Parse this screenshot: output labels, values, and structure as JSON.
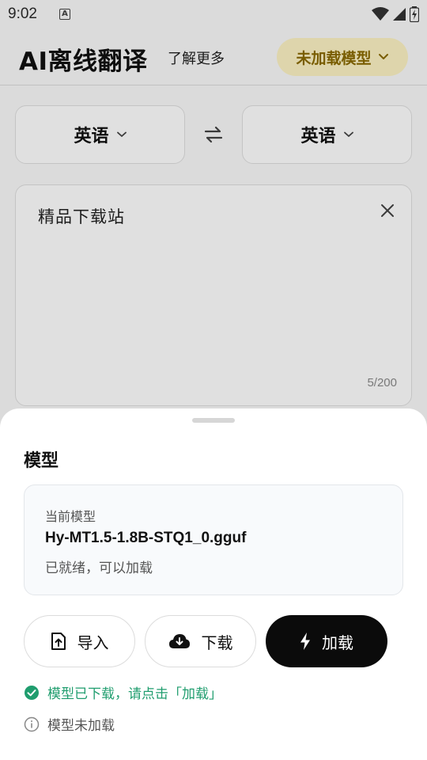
{
  "status_bar": {
    "time": "9:02",
    "notification_glyph": "A",
    "icons": [
      "wifi-icon",
      "signal-icon",
      "battery-icon"
    ]
  },
  "header": {
    "title": "AI离线翻译",
    "learn_more": "了解更多",
    "model_status_button": "未加载模型"
  },
  "languages": {
    "source": "英语",
    "target": "英语"
  },
  "input": {
    "text": "精品下载站",
    "char_count": "5/200"
  },
  "sheet": {
    "title": "模型",
    "current_model_label": "当前模型",
    "current_model_name": "Hy-MT1.5-1.8B-STQ1_0.gguf",
    "current_model_status": "已就绪，可以加载",
    "buttons": {
      "import": "导入",
      "download": "下载",
      "load": "加载"
    },
    "messages": {
      "downloaded": "模型已下载，请点击「加载」",
      "not_loaded": "模型未加载"
    }
  },
  "colors": {
    "accent_pill_bg": "#fdf3c4",
    "accent_pill_text": "#8a6a00",
    "success": "#1f9d6e",
    "primary_button": "#0b0b0b"
  }
}
